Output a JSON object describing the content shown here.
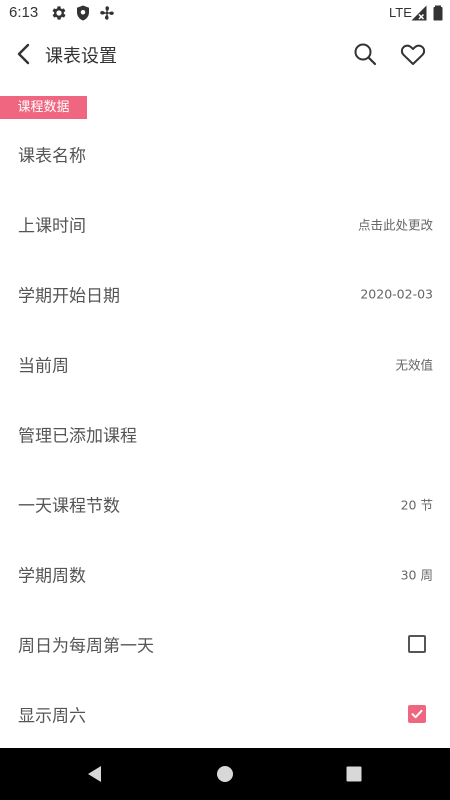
{
  "status_bar": {
    "time": "6:13",
    "network": "LTE",
    "icons": [
      "gear-icon",
      "shield-icon",
      "fan-icon",
      "signal-icon",
      "battery-icon"
    ]
  },
  "toolbar": {
    "title": "课表设置",
    "back_icon": "chevron-left-icon",
    "search_icon": "search-icon",
    "favorite_icon": "heart-icon"
  },
  "section": {
    "label": "课程数据"
  },
  "rows": [
    {
      "title": "课表名称",
      "value": ""
    },
    {
      "title": "上课时间",
      "value": "点击此处更改"
    },
    {
      "title": "学期开始日期",
      "value": "2020-02-03"
    },
    {
      "title": "当前周",
      "value": "无效值"
    },
    {
      "title": "管理已添加课程",
      "value": ""
    },
    {
      "title": "一天课程节数",
      "value": "20 节"
    },
    {
      "title": "学期周数",
      "value": "30 周"
    },
    {
      "title": "周日为每周第一天",
      "checked": false
    },
    {
      "title": "显示周六",
      "checked": true
    }
  ],
  "colors": {
    "accent": "#f0657f",
    "nav_bar": "#000000",
    "text_primary": "#555555",
    "text_secondary": "#666666"
  },
  "nav_bar": {
    "icons": [
      "back-triangle-icon",
      "home-circle-icon",
      "recents-square-icon"
    ]
  }
}
